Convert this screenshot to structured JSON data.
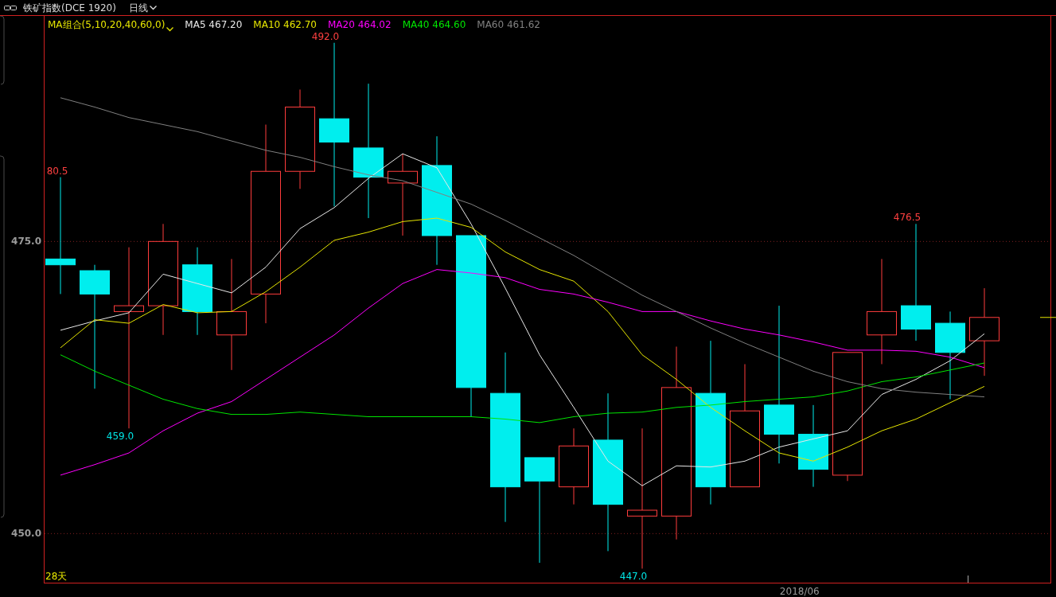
{
  "header": {
    "title": "铁矿指数(DCE 1920)",
    "period": "日线"
  },
  "legend": {
    "label": "MA组合(5,10,20,40,60,0)",
    "values": [
      "467.20",
      "462.70",
      "464.02",
      "464.60",
      "461.62"
    ]
  },
  "chart": {
    "period_count": "28天",
    "x_axis_label": "2018/06",
    "chart_data": {
      "type": "line",
      "ylim": [
        445.8,
        494.3
      ],
      "yticks": [
        {
          "value": 450,
          "label": "450.0"
        },
        {
          "value": 475,
          "label": "475.0"
        }
      ],
      "series": [
        {
          "name": "MA5",
          "color": "#e8e8e8",
          "values": [
            467.4,
            468.2,
            468.9,
            472.2,
            471.4,
            470.6,
            472.8,
            476.1,
            477.9,
            480.4,
            482.5,
            481.3,
            476.5,
            471.0,
            465.3,
            460.8,
            456.2,
            454.1,
            455.8,
            455.7,
            456.2,
            457.4,
            458.1,
            458.8,
            461.9,
            463.2,
            464.8,
            467.1
          ]
        },
        {
          "name": "MA10",
          "color": "#e6e600",
          "values": [
            465.9,
            468.3,
            468.0,
            469.6,
            468.9,
            469.0,
            470.7,
            472.8,
            475.1,
            475.8,
            476.7,
            477.0,
            476.2,
            474.1,
            472.6,
            471.6,
            469.0,
            465.3,
            463.2,
            460.8,
            458.8,
            456.9,
            456.2,
            457.4,
            458.8,
            459.8,
            461.2,
            462.6
          ]
        },
        {
          "name": "MA20",
          "color": "#ff00ff",
          "values": [
            455.0,
            455.9,
            456.9,
            458.8,
            460.3,
            461.3,
            463.2,
            465.1,
            467.0,
            469.3,
            471.4,
            472.6,
            472.3,
            471.9,
            470.9,
            470.5,
            469.8,
            469.0,
            469.0,
            468.2,
            467.5,
            467.0,
            466.4,
            465.7,
            465.7,
            465.6,
            465.1,
            464.2
          ]
        },
        {
          "name": "MA40",
          "color": "#00e600",
          "values": [
            465.3,
            463.9,
            462.7,
            461.5,
            460.7,
            460.2,
            460.2,
            460.4,
            460.2,
            460.0,
            460.0,
            460.0,
            460.0,
            459.8,
            459.5,
            460.0,
            460.3,
            460.4,
            460.8,
            461.0,
            461.3,
            461.5,
            461.7,
            462.2,
            463.0,
            463.4,
            464.0,
            464.6
          ]
        },
        {
          "name": "MA60",
          "color": "#808080",
          "values": [
            487.3,
            486.5,
            485.6,
            485.0,
            484.4,
            483.6,
            482.8,
            482.2,
            481.4,
            480.7,
            480.2,
            479.2,
            478.2,
            476.8,
            475.3,
            473.8,
            472.1,
            470.4,
            469.0,
            467.6,
            466.3,
            465.1,
            463.9,
            463.0,
            462.4,
            462.1,
            461.9,
            461.7
          ]
        }
      ]
    },
    "extreme_labels": [
      {
        "kind": "high",
        "label": "80.5"
      },
      {
        "kind": "high",
        "label": "492.0"
      },
      {
        "kind": "high",
        "label": "476.5"
      },
      {
        "kind": "low",
        "label": "459.0"
      },
      {
        "kind": "low",
        "label": "447.0"
      }
    ]
  }
}
